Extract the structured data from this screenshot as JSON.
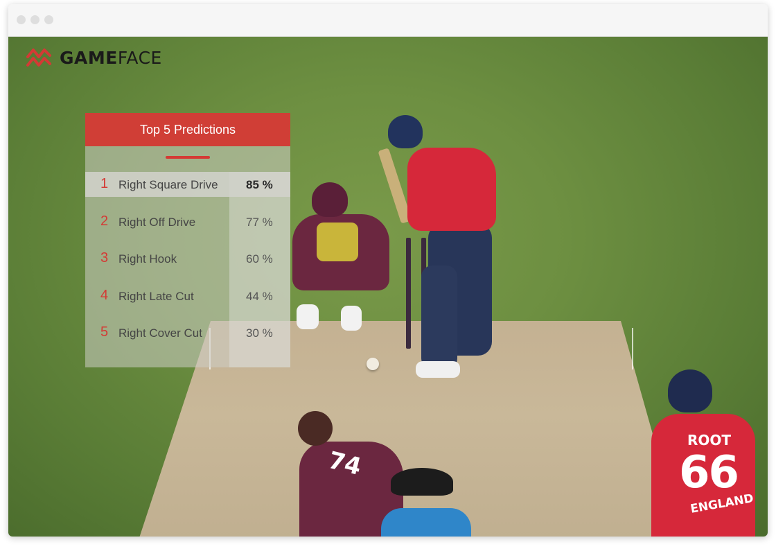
{
  "brand": {
    "name_bold": "GAME",
    "name_light": "FACE",
    "accent_color": "#d43a35"
  },
  "predictions": {
    "title": "Top 5 Predictions",
    "items": [
      {
        "rank": "1",
        "label": "Right Square Drive",
        "value": "85 %"
      },
      {
        "rank": "2",
        "label": "Right Off Drive",
        "value": "77 %"
      },
      {
        "rank": "3",
        "label": "Right Hook",
        "value": "60 %"
      },
      {
        "rank": "4",
        "label": "Right Late Cut",
        "value": "44 %"
      },
      {
        "rank": "5",
        "label": "Right Cover Cut",
        "value": "30 %"
      }
    ]
  },
  "scene": {
    "fielder_jersey_name": "ROOT",
    "fielder_jersey_number": "66",
    "fielder_jersey_country": "ENGLAND",
    "bowler_jersey_number": "74"
  }
}
